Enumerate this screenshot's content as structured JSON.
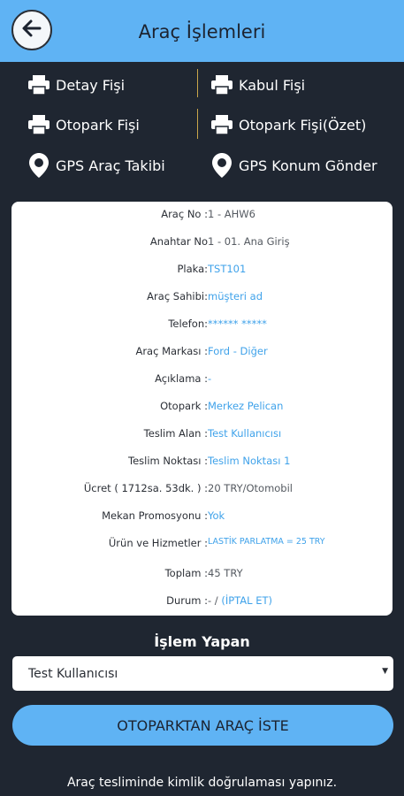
{
  "header": {
    "title": "Araç İşlemleri",
    "back_icon": "arrow-left-icon"
  },
  "actions": [
    {
      "label": "Detay Fişi",
      "icon": "printer-icon"
    },
    {
      "label": "Kabul Fişi",
      "icon": "printer-icon"
    },
    {
      "label": "Otopark Fişi",
      "icon": "printer-icon"
    },
    {
      "label": "Otopark Fişi(Özet)",
      "icon": "printer-icon"
    },
    {
      "label": "GPS Araç Takibi",
      "icon": "map-pin-icon"
    },
    {
      "label": "GPS Konum Gönder",
      "icon": "map-pin-icon"
    }
  ],
  "details": [
    {
      "label": "Araç No :",
      "value": "1 - AHW6"
    },
    {
      "label": "Anahtar No",
      "value": "1 - 01. Ana Giriş"
    },
    {
      "label": "Plaka:",
      "value": "TST101"
    },
    {
      "label": "Araç Sahibi:",
      "value": "müşteri ad"
    },
    {
      "label": "Telefon:",
      "value": "****** *****"
    },
    {
      "label": "Araç Markası :",
      "value": "Ford - Diğer"
    },
    {
      "label": "Açıklama :",
      "value": "-"
    },
    {
      "label": "Otopark :",
      "value": "Merkez Pelican"
    },
    {
      "label": "Teslim Alan :",
      "value": "Test Kullanıcısı"
    },
    {
      "label": "Teslim Noktası :",
      "value": "Teslim Noktası 1"
    },
    {
      "label": "Ücret ( 1712sa. 53dk. ) :",
      "value": "20 TRY/Otomobil"
    },
    {
      "label": "Mekan Promosyonu :",
      "value": "Yok"
    },
    {
      "label": "Ürün ve Hizmetler :",
      "value": "LASTİK PARLATMA = 25 TRY"
    },
    {
      "label": "Toplam :",
      "value": "45 TRY"
    },
    {
      "label": "Durum :",
      "value": "- /",
      "link": "(İPTAL ET)"
    }
  ],
  "operator": {
    "title": "İşlem Yapan",
    "selected": "Test Kullanıcısı"
  },
  "primary_button": "OTOPARKTAN ARAÇ İSTE",
  "footer_note": "Araç tesliminde kimlik doğrulaması yapınız.",
  "colors": {
    "accent": "#5fb3f4",
    "background": "#1f2631",
    "link": "#3fa2ea"
  }
}
